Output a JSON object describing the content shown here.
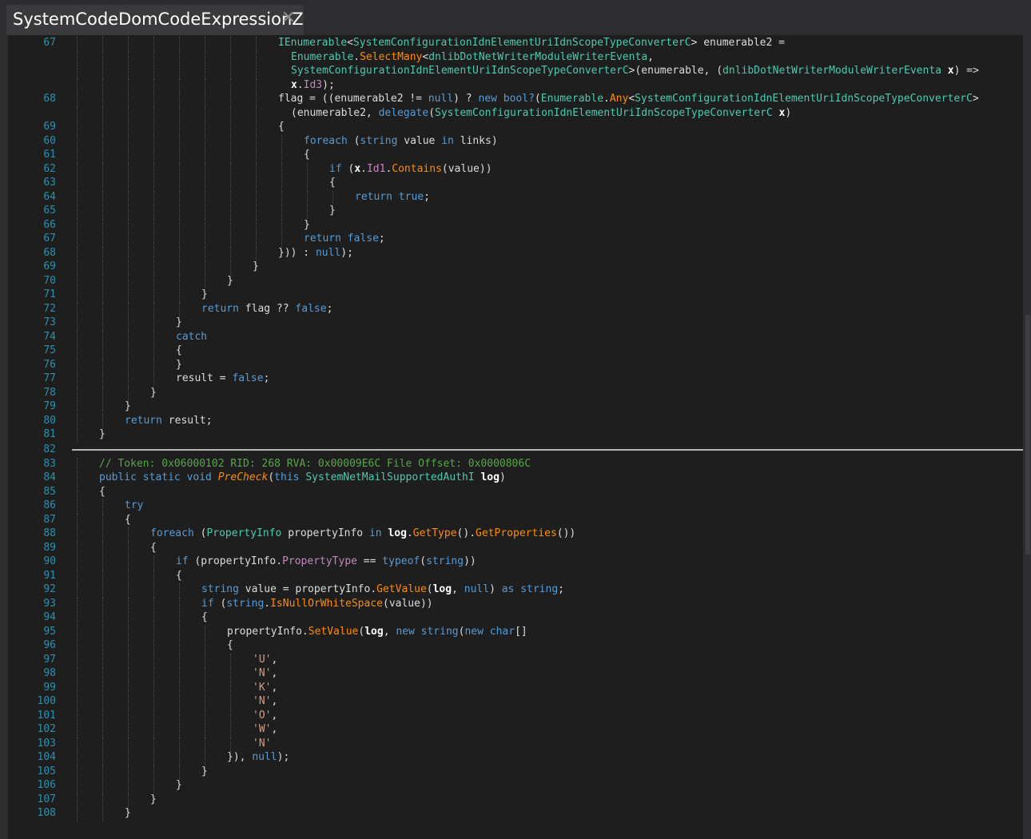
{
  "tab": {
    "title": "SystemCodeDomCodeExpressionZ",
    "close_glyph": "✕"
  },
  "colors": {
    "keyword": "#569cd6",
    "type": "#4ec9b0",
    "method": "#ff8c00",
    "comment": "#57a64a",
    "string": "#d69d85",
    "line_number": "#2b91af"
  },
  "code": {
    "lines": [
      {
        "n": "67",
        "indent": 8,
        "segments": [
          [
            "ty",
            "IEnumerable"
          ],
          [
            "id",
            "<"
          ],
          [
            "ty",
            "SystemConfigurationIdnElementUriIdnScopeTypeConverterC"
          ],
          [
            "id",
            "> enumerable2 ="
          ]
        ]
      },
      {
        "n": "",
        "indent": 8.5,
        "segments": [
          [
            "ty",
            "Enumerable"
          ],
          [
            "id",
            "."
          ],
          [
            "mt",
            "SelectMany"
          ],
          [
            "id",
            "<"
          ],
          [
            "ty",
            "dnlibDotNetWriterModuleWriterEventa"
          ],
          [
            "id",
            ","
          ]
        ]
      },
      {
        "n": "",
        "indent": 8.5,
        "segments": [
          [
            "ty",
            "SystemConfigurationIdnElementUriIdnScopeTypeConverterC"
          ],
          [
            "id",
            ">(enumerable, ("
          ],
          [
            "ty",
            "dnlibDotNetWriterModuleWriterEventa"
          ],
          [
            "bd",
            " x"
          ],
          [
            "id",
            ") =>"
          ]
        ]
      },
      {
        "n": "",
        "indent": 8.5,
        "segments": [
          [
            "bd",
            "x"
          ],
          [
            "id",
            "."
          ],
          [
            "pr",
            "Id3"
          ],
          [
            "id",
            ");"
          ]
        ]
      },
      {
        "n": "68",
        "indent": 8,
        "segments": [
          [
            "id",
            "flag = ((enumerable2 != "
          ],
          [
            "kw",
            "null"
          ],
          [
            "id",
            ") ? "
          ],
          [
            "kw",
            "new bool?"
          ],
          [
            "id",
            "("
          ],
          [
            "ty",
            "Enumerable"
          ],
          [
            "id",
            "."
          ],
          [
            "mt",
            "Any"
          ],
          [
            "id",
            "<"
          ],
          [
            "ty",
            "SystemConfigurationIdnElementUriIdnScopeTypeConverterC"
          ],
          [
            "id",
            ">"
          ]
        ]
      },
      {
        "n": "",
        "indent": 8.5,
        "segments": [
          [
            "id",
            "(enumerable2, "
          ],
          [
            "kw",
            "delegate"
          ],
          [
            "id",
            "("
          ],
          [
            "ty",
            "SystemConfigurationIdnElementUriIdnScopeTypeConverterC"
          ],
          [
            "bd",
            " x"
          ],
          [
            "id",
            ")"
          ]
        ]
      },
      {
        "n": "69",
        "indent": 8,
        "segments": [
          [
            "id",
            "{"
          ]
        ]
      },
      {
        "n": "60",
        "indent": 9,
        "segments": [
          [
            "kw",
            "foreach"
          ],
          [
            "id",
            " ("
          ],
          [
            "kw",
            "string"
          ],
          [
            "id",
            " value "
          ],
          [
            "kw",
            "in"
          ],
          [
            "id",
            " links)"
          ]
        ]
      },
      {
        "n": "61",
        "indent": 9,
        "segments": [
          [
            "id",
            "{"
          ]
        ]
      },
      {
        "n": "62",
        "indent": 10,
        "segments": [
          [
            "kw",
            "if"
          ],
          [
            "id",
            " ("
          ],
          [
            "bd",
            "x"
          ],
          [
            "id",
            "."
          ],
          [
            "pr",
            "Id1"
          ],
          [
            "id",
            "."
          ],
          [
            "mt",
            "Contains"
          ],
          [
            "id",
            "(value))"
          ]
        ]
      },
      {
        "n": "63",
        "indent": 10,
        "segments": [
          [
            "id",
            "{"
          ]
        ]
      },
      {
        "n": "64",
        "indent": 11,
        "segments": [
          [
            "kw",
            "return true"
          ],
          [
            "id",
            ";"
          ]
        ]
      },
      {
        "n": "65",
        "indent": 10,
        "segments": [
          [
            "id",
            "}"
          ]
        ]
      },
      {
        "n": "66",
        "indent": 9,
        "segments": [
          [
            "id",
            "}"
          ]
        ]
      },
      {
        "n": "67",
        "indent": 9,
        "segments": [
          [
            "kw",
            "return false"
          ],
          [
            "id",
            ";"
          ]
        ]
      },
      {
        "n": "68",
        "indent": 8,
        "segments": [
          [
            "id",
            "})) : "
          ],
          [
            "kw",
            "null"
          ],
          [
            "id",
            ");"
          ]
        ]
      },
      {
        "n": "69",
        "indent": 7,
        "segments": [
          [
            "id",
            "}"
          ]
        ]
      },
      {
        "n": "70",
        "indent": 6,
        "segments": [
          [
            "id",
            "}"
          ]
        ]
      },
      {
        "n": "71",
        "indent": 5,
        "segments": [
          [
            "id",
            "}"
          ]
        ]
      },
      {
        "n": "72",
        "indent": 5,
        "segments": [
          [
            "kw",
            "return"
          ],
          [
            "id",
            " flag ?? "
          ],
          [
            "kw",
            "false"
          ],
          [
            "id",
            ";"
          ]
        ]
      },
      {
        "n": "73",
        "indent": 4,
        "segments": [
          [
            "id",
            "}"
          ]
        ]
      },
      {
        "n": "74",
        "indent": 4,
        "segments": [
          [
            "kw",
            "catch"
          ]
        ]
      },
      {
        "n": "75",
        "indent": 4,
        "segments": [
          [
            "id",
            "{"
          ]
        ]
      },
      {
        "n": "76",
        "indent": 4,
        "segments": [
          [
            "id",
            "}"
          ]
        ]
      },
      {
        "n": "77",
        "indent": 4,
        "segments": [
          [
            "id",
            "result = "
          ],
          [
            "kw",
            "false"
          ],
          [
            "id",
            ";"
          ]
        ]
      },
      {
        "n": "78",
        "indent": 3,
        "segments": [
          [
            "id",
            "}"
          ]
        ]
      },
      {
        "n": "79",
        "indent": 2,
        "segments": [
          [
            "id",
            "}"
          ]
        ]
      },
      {
        "n": "80",
        "indent": 2,
        "segments": [
          [
            "kw",
            "return"
          ],
          [
            "id",
            " result;"
          ]
        ]
      },
      {
        "n": "81",
        "indent": 1,
        "segments": [
          [
            "id",
            "}"
          ]
        ]
      },
      {
        "n": "82",
        "indent": 0,
        "segments": []
      },
      {
        "n": "83",
        "indent": 1,
        "segments": [
          [
            "cm",
            "// Token: 0x06000102 RID: 268 RVA: 0x00009E6C File Offset: 0x0000806C"
          ]
        ]
      },
      {
        "n": "84",
        "indent": 1,
        "segments": [
          [
            "kw",
            "public static void "
          ],
          [
            "fn",
            "PreCheck"
          ],
          [
            "id",
            "("
          ],
          [
            "kw",
            "this "
          ],
          [
            "ty",
            "SystemNetMailSupportedAuthI"
          ],
          [
            "bd",
            " log"
          ],
          [
            "id",
            ")"
          ]
        ]
      },
      {
        "n": "85",
        "indent": 1,
        "segments": [
          [
            "id",
            "{"
          ]
        ]
      },
      {
        "n": "86",
        "indent": 2,
        "segments": [
          [
            "kw",
            "try"
          ]
        ]
      },
      {
        "n": "87",
        "indent": 2,
        "segments": [
          [
            "id",
            "{"
          ]
        ]
      },
      {
        "n": "88",
        "indent": 3,
        "segments": [
          [
            "kw",
            "foreach"
          ],
          [
            "id",
            " ("
          ],
          [
            "ty",
            "PropertyInfo"
          ],
          [
            "id",
            " propertyInfo "
          ],
          [
            "kw",
            "in"
          ],
          [
            "bd",
            " log"
          ],
          [
            "id",
            "."
          ],
          [
            "mt",
            "GetType"
          ],
          [
            "id",
            "()."
          ],
          [
            "mt",
            "GetProperties"
          ],
          [
            "id",
            "())"
          ]
        ]
      },
      {
        "n": "89",
        "indent": 3,
        "segments": [
          [
            "id",
            "{"
          ]
        ]
      },
      {
        "n": "90",
        "indent": 4,
        "segments": [
          [
            "kw",
            "if"
          ],
          [
            "id",
            " (propertyInfo."
          ],
          [
            "pr",
            "PropertyType"
          ],
          [
            "id",
            " == "
          ],
          [
            "kw",
            "typeof"
          ],
          [
            "id",
            "("
          ],
          [
            "kw",
            "string"
          ],
          [
            "id",
            "))"
          ]
        ]
      },
      {
        "n": "91",
        "indent": 4,
        "segments": [
          [
            "id",
            "{"
          ]
        ]
      },
      {
        "n": "92",
        "indent": 5,
        "segments": [
          [
            "kw",
            "string"
          ],
          [
            "id",
            " value = propertyInfo."
          ],
          [
            "mt",
            "GetValue"
          ],
          [
            "id",
            "("
          ],
          [
            "bd",
            "log"
          ],
          [
            "id",
            ", "
          ],
          [
            "kw",
            "null"
          ],
          [
            "id",
            ") "
          ],
          [
            "kw",
            "as string"
          ],
          [
            "id",
            ";"
          ]
        ]
      },
      {
        "n": "93",
        "indent": 5,
        "segments": [
          [
            "kw",
            "if"
          ],
          [
            "id",
            " ("
          ],
          [
            "kw",
            "string"
          ],
          [
            "id",
            "."
          ],
          [
            "mt",
            "IsNullOrWhiteSpace"
          ],
          [
            "id",
            "(value))"
          ]
        ]
      },
      {
        "n": "94",
        "indent": 5,
        "segments": [
          [
            "id",
            "{"
          ]
        ]
      },
      {
        "n": "95",
        "indent": 6,
        "segments": [
          [
            "id",
            "propertyInfo."
          ],
          [
            "mt",
            "SetValue"
          ],
          [
            "id",
            "("
          ],
          [
            "bd",
            "log"
          ],
          [
            "id",
            ", "
          ],
          [
            "kw",
            "new string"
          ],
          [
            "id",
            "("
          ],
          [
            "kw",
            "new char"
          ],
          [
            "id",
            "[]"
          ]
        ]
      },
      {
        "n": "96",
        "indent": 6,
        "segments": [
          [
            "id",
            "{"
          ]
        ]
      },
      {
        "n": "97",
        "indent": 7,
        "segments": [
          [
            "st",
            "'U'"
          ],
          [
            "id",
            ","
          ]
        ]
      },
      {
        "n": "98",
        "indent": 7,
        "segments": [
          [
            "st",
            "'N'"
          ],
          [
            "id",
            ","
          ]
        ]
      },
      {
        "n": "99",
        "indent": 7,
        "segments": [
          [
            "st",
            "'K'"
          ],
          [
            "id",
            ","
          ]
        ]
      },
      {
        "n": "100",
        "indent": 7,
        "segments": [
          [
            "st",
            "'N'"
          ],
          [
            "id",
            ","
          ]
        ]
      },
      {
        "n": "101",
        "indent": 7,
        "segments": [
          [
            "st",
            "'O'"
          ],
          [
            "id",
            ","
          ]
        ]
      },
      {
        "n": "102",
        "indent": 7,
        "segments": [
          [
            "st",
            "'W'"
          ],
          [
            "id",
            ","
          ]
        ]
      },
      {
        "n": "103",
        "indent": 7,
        "segments": [
          [
            "st",
            "'N'"
          ]
        ]
      },
      {
        "n": "104",
        "indent": 6,
        "segments": [
          [
            "id",
            "}), "
          ],
          [
            "kw",
            "null"
          ],
          [
            "id",
            ");"
          ]
        ]
      },
      {
        "n": "105",
        "indent": 5,
        "segments": [
          [
            "id",
            "}"
          ]
        ]
      },
      {
        "n": "106",
        "indent": 4,
        "segments": [
          [
            "id",
            "}"
          ]
        ]
      },
      {
        "n": "107",
        "indent": 3,
        "segments": [
          [
            "id",
            "}"
          ]
        ]
      },
      {
        "n": "108",
        "indent": 2,
        "segments": [
          [
            "id",
            "}"
          ]
        ]
      }
    ]
  }
}
